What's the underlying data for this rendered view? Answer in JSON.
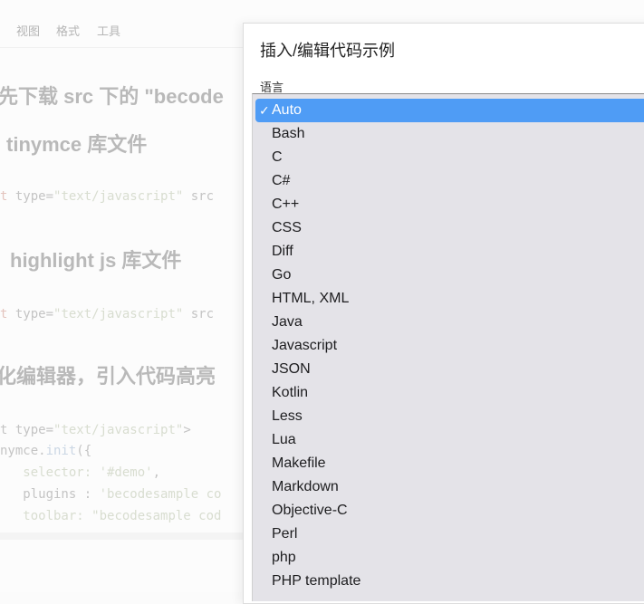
{
  "menubar": {
    "items": [
      "视图",
      "格式",
      "工具"
    ]
  },
  "editor": {
    "headings": [
      "先下载 src 下的 \"becode",
      "tinymce 库文件",
      "highlight js 库文件",
      "化编辑器，引入代码高亮"
    ],
    "code": [
      {
        "a": "t",
        "b": " type=",
        "c": "\"text/javascript\"",
        "d": " src"
      },
      {
        "a": "t",
        "b": " type=",
        "c": "\"text/javascript\"",
        "d": " src"
      },
      {
        "a": "t",
        "b": " type=",
        "c": "\"text/javascript\"",
        "d": ">"
      },
      {
        "a": "nymce.",
        "b": "init",
        "c": "({",
        "d": ""
      },
      {
        "a": "   selector: ",
        "b": "'#demo'",
        "c": ",",
        "d": ""
      },
      {
        "a": "   plugins : ",
        "b": "'becodesample co",
        "c": "",
        "d": ""
      },
      {
        "a": "   toolbar: ",
        "b": "\"becodesample cod",
        "c": "",
        "d": ""
      }
    ]
  },
  "dialog": {
    "title": "插入/编辑代码示例",
    "language_label": "语言",
    "selected": "Auto",
    "check": "✓",
    "options": [
      "Auto",
      "Bash",
      "C",
      "C#",
      "C++",
      "CSS",
      "Diff",
      "Go",
      "HTML, XML",
      "Java",
      "Javascript",
      "JSON",
      "Kotlin",
      "Less",
      "Lua",
      "Makefile",
      "Markdown",
      "Objective-C",
      "Perl",
      "php",
      "PHP template"
    ]
  }
}
